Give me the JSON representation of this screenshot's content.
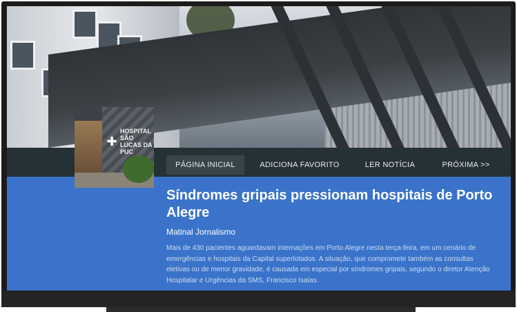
{
  "nav": {
    "home": "PÁGINA INICIAL",
    "favorite": "ADICIONA FAVORITO",
    "read": "LER NOTÍCIA",
    "next": "PRÓXIMA >>"
  },
  "thumbnail": {
    "sign_text": "HOSPITAL SÃO LUCAS DA PUC"
  },
  "article": {
    "title": "Síndromes gripais pressionam hospitais de Porto Alegre",
    "source": "Matinal Jornalismo",
    "summary": "Mais de 430 pacientes aguardavam internações em Porto Alegre nesta terça-feira, em um cenário de emergências e hospitais da Capital superlotados. A situação, que compromete também as consultas eletivas ou de menor gravidade, é causada em especial por síndromes gripais, segundo o diretor Atenção Hospitalar e Urgências da SMS, Francisco Isaías."
  },
  "colors": {
    "accent_blue": "#3a73c9",
    "navbar": "#263136",
    "active_tab": "#37454b"
  }
}
